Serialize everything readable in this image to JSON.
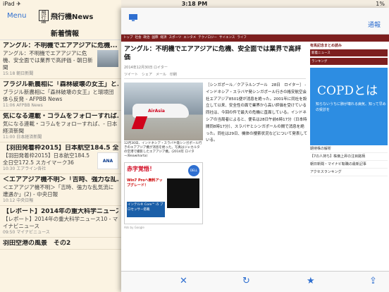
{
  "status": {
    "left": "iPad ✈",
    "time": "3:18 PM",
    "right": "1%"
  },
  "left_nav": {
    "menu_label": "Menu",
    "logo_mark": "飛行機",
    "logo_text": "飛行機News",
    "title": "新着情報"
  },
  "items": [
    {
      "title": "アングル：不明機でエアアジアに危機...",
      "summary": "アングル：不明機でエアアジアに危機、安全面では業界で高評価 - 朝日新聞",
      "meta": "15:18 朝日新聞",
      "thumb": "plane"
    },
    {
      "title": "ブラジル新農相に「森林破壊の女王」と...",
      "summary": "ブラジル新農相に「森林破壊の女王」と環境団体ら反発 - AFPBB News",
      "meta": "11:06 AFPBB News",
      "thumb": ""
    },
    {
      "title": "気になる連載・コラムをフォローすれば...",
      "summary": "気になる連載・コラムをフォローすれば、- 日本経済新聞",
      "meta": "11:00 日本経済新聞",
      "thumb": ""
    },
    {
      "title": "【羽田発着枠2015】日本航空184.5 全...",
      "summary": "【羽田発着枠2015】日本航空184.5 全日空172.5 スカイマーク36",
      "meta": "10:30 エアライン各社",
      "thumb": "ana"
    },
    {
      "title": "＜エアアジア機不明＞「吉時、強力な乱...",
      "summary": "＜エアアジア機不明＞「吉時、強力な乱気流に遭遇か」(2) - 中央日報",
      "meta": "10:12 中央日報",
      "thumb": ""
    },
    {
      "title": "【レポート】2014年の重大科学ニュース1...",
      "summary": "【レポート】2014年の重大科学ニュース10 - マイナビニュース",
      "meta": "09:50 マイナビニュース",
      "thumb": ""
    },
    {
      "title": "羽田空港の風景　その2",
      "summary": "",
      "meta": "",
      "thumb": ""
    }
  ],
  "detail": {
    "report_label": "通報",
    "nav": [
      "トップ",
      "社会",
      "政治",
      "国際",
      "経済",
      "スポーツ",
      "エンタメ",
      "テクノロジー",
      "サイエンス",
      "ライフ"
    ],
    "headline": "アングル：不明機でエアアジアに危機、安全面では業界で高評価",
    "byline": "2014年12月30日 ロイター",
    "share": "ツイート　シェア　メール　印刷",
    "photo_brand": "AirAsia",
    "caption": "12月30日、インドネシア・スラバヤ発シンガポール行きのエアアジア機が消息を絶った。写真はジャカルタの空港で撮影したエアアジア機。(2014年 ロイター/Beawiharta)",
    "ad_alert": "赤字覚悟！",
    "ad_brand": "DELL",
    "ad_win": "Win7 Proへ無料アップグレード！",
    "ad_intel": "インテル® Core™ i5 プロセッサー搭載",
    "ad_by": "Ads by Google",
    "body": "［シンガポール／クアラルンプール　28日　ロイター］ - インドネシア・スラバヤ発シンガポール行きの格安航空会社エアアジア8501便が消息を絶った。2001年に同社を設立して以来、安全性の面で業界から高い評価を受けている同社は、今回の件で最大の危機に直面している。インドネシアの当局者によると、便名は28日午前6時17分（日本時間同8時17分）、スラバヤとシンガポールの間で消息を絶った。同社は29日、機体の捜索状況などについて発表している。",
    "sidebar_head": "有馬記念まとめ読み",
    "sidebar_blocks": [
      "新着ニュース",
      "ランキング"
    ],
    "copd_big": "COPDとは",
    "copd_small": "知らないうちに肺が壊れる病気、知って早めの受診を",
    "sidebar_lines": [
      "期待株の解析",
      "【7の人持ち】株価上昇の注目銘柄",
      "朝日新聞・マイナビ転職の最新記事",
      "アクセスランキング"
    ]
  },
  "toolbar": {
    "close": "✕",
    "reload": "↻",
    "star": "★",
    "share": "⇪"
  }
}
